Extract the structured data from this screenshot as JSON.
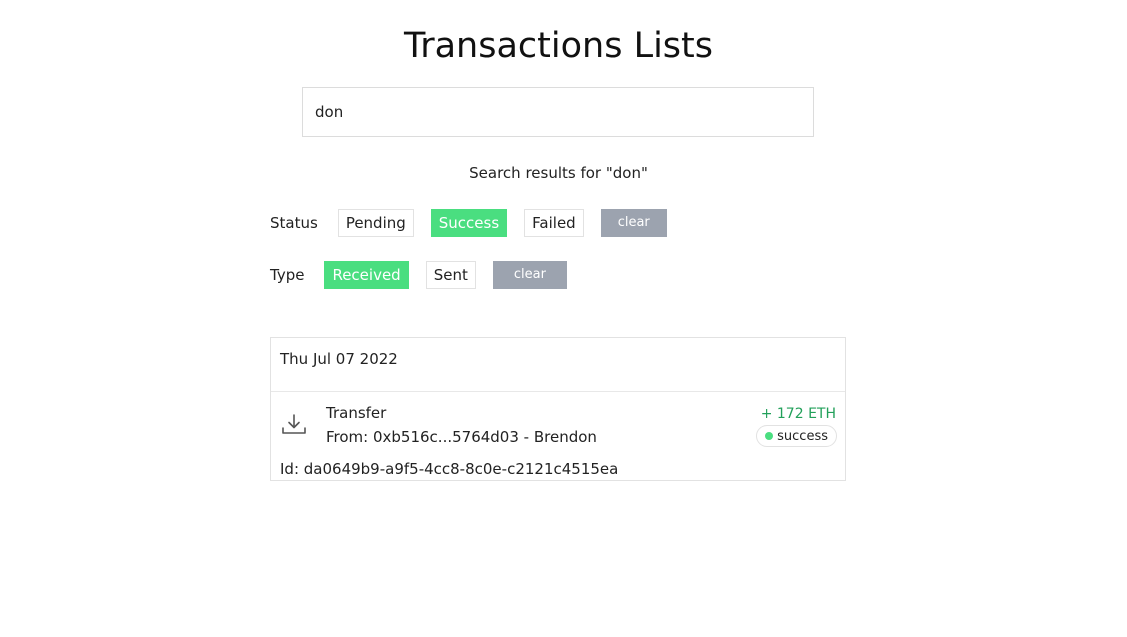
{
  "page": {
    "title": "Transactions Lists"
  },
  "search": {
    "value": "don",
    "results_text": "Search results for \"don\""
  },
  "filters": {
    "status": {
      "label": "Status",
      "options": [
        {
          "label": "Pending",
          "active": false
        },
        {
          "label": "Success",
          "active": true
        },
        {
          "label": "Failed",
          "active": false
        }
      ],
      "clear_label": "clear"
    },
    "type": {
      "label": "Type",
      "options": [
        {
          "label": "Received",
          "active": true
        },
        {
          "label": "Sent",
          "active": false
        }
      ],
      "clear_label": "clear"
    }
  },
  "transactions": [
    {
      "date": "Thu Jul 07 2022",
      "icon": "download-icon",
      "title": "Transfer",
      "from": "From: 0xb516c...5764d03 - Brendon",
      "amount": "+ 172 ETH",
      "status": "success",
      "id": "Id: da0649b9-a9f5-4cc8-8c0e-c2121c4515ea"
    }
  ],
  "colors": {
    "active_chip": "#4ade80",
    "clear_button": "#9ca3af",
    "amount_positive": "#22a05a",
    "status_success_dot": "#4ade80"
  }
}
